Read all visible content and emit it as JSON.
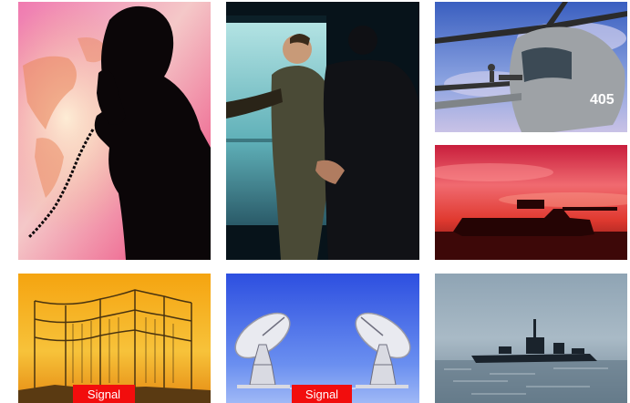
{
  "tiles": {
    "phone": {
      "icon": "silhouette-phone-world-map"
    },
    "office": {
      "icon": "two-men-office-meeting"
    },
    "heli": {
      "icon": "military-helicopter"
    },
    "tank": {
      "icon": "tank-silhouette-sunset"
    },
    "antenna": {
      "icon": "antenna-array-field",
      "label": "Signal"
    },
    "dish": {
      "icon": "satellite-dish-pair",
      "label": "Signal"
    },
    "ship": {
      "icon": "warship-silhouette-sea"
    }
  },
  "colors": {
    "signal_red": "#f20d0d",
    "dish_blue": "#1d3ad8",
    "sunset_orange": "#f3a21a",
    "sunset_red": "#d9253b"
  }
}
